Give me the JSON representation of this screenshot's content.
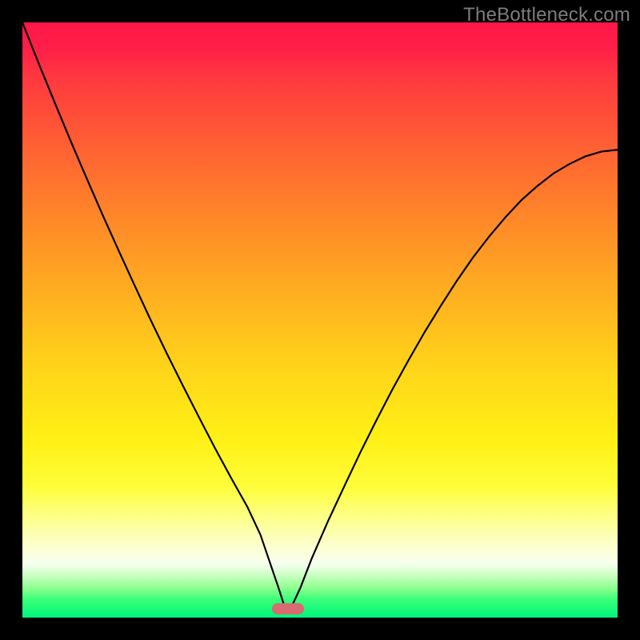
{
  "watermark": "TheBottleneck.com",
  "chart_data": {
    "type": "line",
    "title": "",
    "xlabel": "",
    "ylabel": "",
    "xlim": [
      0,
      100
    ],
    "ylim": [
      0,
      100
    ],
    "grid": false,
    "legend": false,
    "series": [
      {
        "name": "bottleneck-curve",
        "x": [
          0.0,
          2.7,
          5.4,
          8.1,
          10.8,
          13.5,
          16.2,
          18.9,
          21.6,
          24.3,
          27.0,
          29.7,
          32.4,
          35.1,
          37.8,
          40.0,
          41.5,
          43.0,
          44.0,
          45.3,
          46.7,
          48.6,
          51.3,
          54.1,
          56.8,
          59.5,
          62.2,
          64.9,
          67.6,
          70.3,
          73.0,
          75.7,
          78.4,
          81.1,
          83.8,
          86.5,
          89.2,
          91.9,
          94.6,
          97.3,
          100.0
        ],
        "y": [
          100.0,
          93.2,
          86.6,
          80.1,
          73.8,
          67.6,
          61.6,
          55.7,
          49.9,
          44.3,
          38.9,
          33.6,
          28.4,
          23.4,
          18.6,
          13.9,
          9.5,
          5.1,
          2.0,
          2.0,
          5.0,
          9.9,
          16.1,
          22.1,
          27.8,
          33.2,
          38.4,
          43.3,
          48.0,
          52.4,
          56.6,
          60.5,
          64.0,
          67.2,
          70.1,
          72.5,
          74.6,
          76.2,
          77.5,
          78.3,
          78.6
        ]
      }
    ],
    "marker": {
      "name": "optimal-range",
      "x_center": 44.6,
      "width_pct": 5.4,
      "y": 1.5,
      "color": "#d96a6f"
    },
    "background_gradient": {
      "top": "#ff1648",
      "mid": "#ffe018",
      "bottom": "#00f57c"
    }
  }
}
